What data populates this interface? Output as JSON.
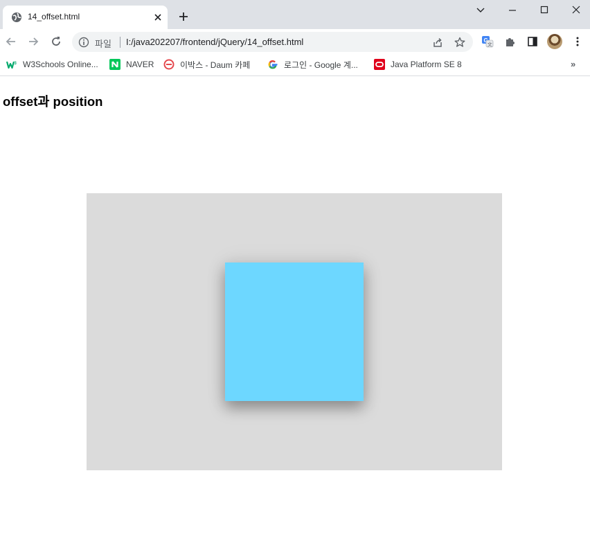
{
  "browser": {
    "tab": {
      "title": "14_offset.html"
    },
    "omnibox": {
      "scheme_label": "파일",
      "url": "I:/java202207/frontend/jQuery/14_offset.html"
    },
    "bookmarks": [
      {
        "label": "W3Schools Online...",
        "icon": "w3schools-icon",
        "color": "#04aa6d"
      },
      {
        "label": "NAVER",
        "icon": "naver-icon",
        "color": "#03c75a"
      },
      {
        "label": "이박스 - Daum 카페",
        "icon": "daum-cafe-icon",
        "color": "#e5484d"
      },
      {
        "label": "로그인 - Google 계...",
        "icon": "google-icon",
        "color": "#4285f4"
      },
      {
        "label": "Java Platform SE 8",
        "icon": "oracle-icon",
        "color": "#e0001b"
      }
    ],
    "bookmarks_overflow": "»"
  },
  "page": {
    "heading": "offset과 position",
    "colors": {
      "outer_box": "#dbdbdb",
      "inner_box": "#6dd7ff"
    }
  }
}
